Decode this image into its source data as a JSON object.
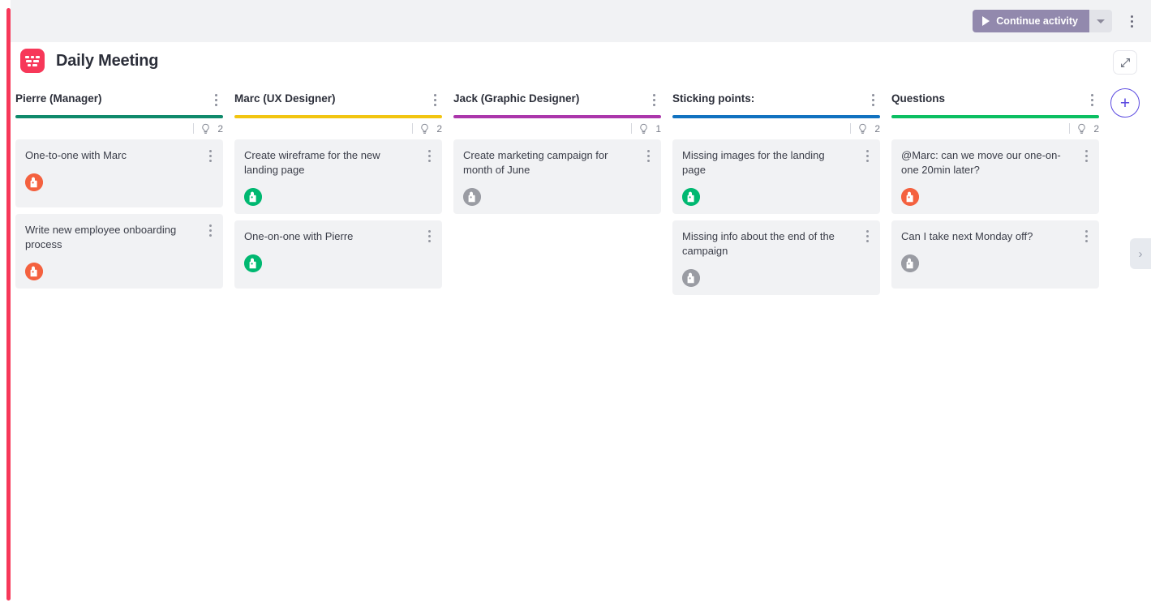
{
  "toolbar": {
    "continue_label": "Continue activity",
    "play_icon": "play-icon",
    "caret_icon": "chevron-down-icon",
    "kebab_icon": "more-options-icon",
    "accent_color": "#9289ad"
  },
  "board": {
    "title": "Daily Meeting",
    "logo_icon": "board-logo-icon",
    "logo_color": "#f73859",
    "accent_stripe_color": "#f73859"
  },
  "controls": {
    "collapse_icon": "collapse-arrows-icon",
    "add_label": "+",
    "edge_tab_icon": "chevron-right-icon",
    "add_color": "#5b4ae0"
  },
  "columns": [
    {
      "title": "Pierre (Manager)",
      "color": "#0f8a6b",
      "idea_icon": "lightbulb-icon",
      "count": "2",
      "cards": [
        {
          "text": "One-to-one with Marc",
          "avatar": "avatar-pierre",
          "avatar_color": "#f4613f"
        },
        {
          "text": "Write new employee onboarding process",
          "avatar": "avatar-pierre",
          "avatar_color": "#f4613f"
        }
      ]
    },
    {
      "title": "Marc (UX Designer)",
      "color": "#f2c511",
      "idea_icon": "lightbulb-icon",
      "count": "2",
      "cards": [
        {
          "text": "Create wireframe for the new landing page",
          "avatar": "avatar-marc",
          "avatar_color": "#00b871"
        },
        {
          "text": "One-on-one with Pierre",
          "avatar": "avatar-marc",
          "avatar_color": "#00b871"
        }
      ]
    },
    {
      "title": "Jack (Graphic Designer)",
      "color": "#ab36ab",
      "idea_icon": "lightbulb-icon",
      "count": "1",
      "cards": [
        {
          "text": "Create marketing campaign for month of June",
          "avatar": "avatar-jack",
          "avatar_color": "#9a9ca3"
        }
      ]
    },
    {
      "title": "Sticking points:",
      "color": "#1172c0",
      "idea_icon": "lightbulb-icon",
      "count": "2",
      "cards": [
        {
          "text": "Missing images for the landing page",
          "avatar": "avatar-marc",
          "avatar_color": "#00b871"
        },
        {
          "text": "Missing info about the end of the campaign",
          "avatar": "avatar-jack",
          "avatar_color": "#9a9ca3"
        }
      ]
    },
    {
      "title": "Questions",
      "color": "#0bbf62",
      "idea_icon": "lightbulb-icon",
      "count": "2",
      "cards": [
        {
          "text": "@Marc: can we move our one-on-one 20min later?",
          "avatar": "avatar-pierre",
          "avatar_color": "#f4613f"
        },
        {
          "text": "Can I take next Monday off?",
          "avatar": "avatar-jack",
          "avatar_color": "#9a9ca3"
        }
      ]
    }
  ]
}
